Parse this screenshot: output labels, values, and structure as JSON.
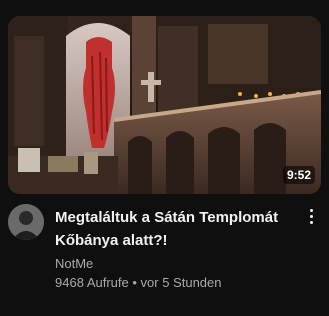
{
  "video": {
    "title": "Megtaláltuk a Sátán Templomát Kőbánya alatt?!",
    "duration": "9:52",
    "channel": "NotMe",
    "views": "9468 Aufrufe",
    "separator": "•",
    "age": "vor 5 Stunden"
  },
  "icons": {
    "menu": "more-vert-icon",
    "avatar": "channel-avatar"
  },
  "colors": {
    "background": "#0f0f0f",
    "title": "#f1f1f1",
    "secondary_text": "#aaaaaa"
  }
}
